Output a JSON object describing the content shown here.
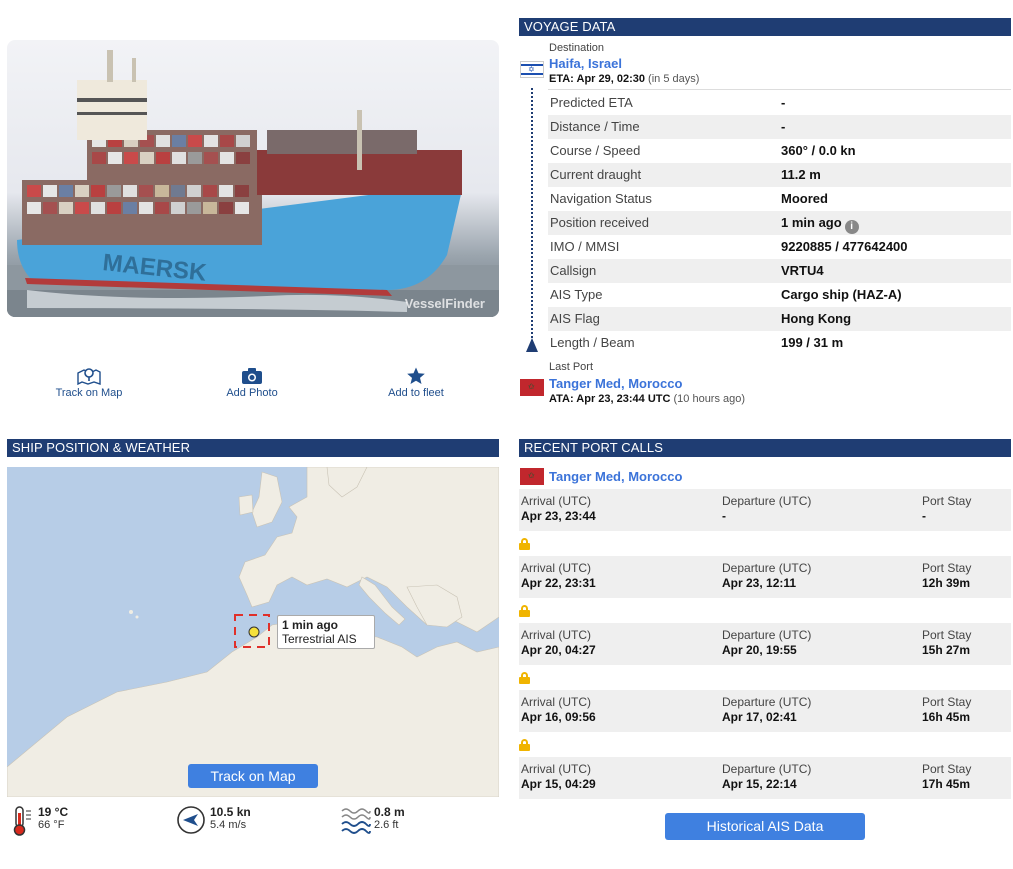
{
  "photo": {
    "watermark": "VesselFinder",
    "hull_text": "MAERSK"
  },
  "actions": [
    {
      "label": "Track on Map",
      "icon": "map-pin-icon"
    },
    {
      "label": "Add Photo",
      "icon": "camera-icon"
    },
    {
      "label": "Add to fleet",
      "icon": "star-icon"
    }
  ],
  "voyage": {
    "header": "VOYAGE DATA",
    "destination": {
      "label": "Destination",
      "port": "Haifa, Israel",
      "eta_prefix": "ETA: Apr 29, 02:30",
      "eta_note": "(in 5 days)"
    },
    "rows": [
      {
        "label": "Predicted ETA",
        "value": "-"
      },
      {
        "label": "Distance / Time",
        "value": "-"
      },
      {
        "label": "Course / Speed",
        "value": "360° / 0.0 kn"
      },
      {
        "label": "Current draught",
        "value": "11.2 m"
      },
      {
        "label": "Navigation Status",
        "value": "Moored"
      },
      {
        "label": "Position received",
        "value": "1 min ago"
      },
      {
        "label": "IMO / MMSI",
        "value": "9220885 / 477642400"
      },
      {
        "label": "Callsign",
        "value": "VRTU4"
      },
      {
        "label": "AIS Type",
        "value": "Cargo ship (HAZ-A)"
      },
      {
        "label": "AIS Flag",
        "value": "Hong Kong"
      },
      {
        "label": "Length / Beam",
        "value": "199 / 31 m"
      }
    ],
    "last_port": {
      "label": "Last Port",
      "port": "Tanger Med, Morocco",
      "ata_prefix": "ATA: Apr 23, 23:44 UTC",
      "ata_note": "(10 hours ago)"
    }
  },
  "map": {
    "header": "SHIP POSITION & WEATHER",
    "tooltip_time": "1 min ago",
    "tooltip_source": "Terrestrial AIS",
    "button": "Track on Map",
    "colors": {
      "sea": "#b7cde7",
      "land": "#f0ede4"
    }
  },
  "weather": {
    "temp_c": "19 °C",
    "temp_f": "66 °F",
    "wind_kn": "10.5 kn",
    "wind_ms": "5.4 m/s",
    "wave_m": "0.8 m",
    "wave_ft": "2.6 ft"
  },
  "port_calls": {
    "header": "RECENT PORT CALLS",
    "port": "Tanger Med, Morocco",
    "col_arrival": "Arrival (UTC)",
    "col_departure": "Departure (UTC)",
    "col_stay": "Port Stay",
    "rows": [
      {
        "arrival": "Apr 23, 23:44",
        "departure": "-",
        "stay": "-"
      },
      {
        "arrival": "Apr 22, 23:31",
        "departure": "Apr 23, 12:11",
        "stay": "12h 39m"
      },
      {
        "arrival": "Apr 20, 04:27",
        "departure": "Apr 20, 19:55",
        "stay": "15h 27m"
      },
      {
        "arrival": "Apr 16, 09:56",
        "departure": "Apr 17, 02:41",
        "stay": "16h 45m"
      },
      {
        "arrival": "Apr 15, 04:29",
        "departure": "Apr 15, 22:14",
        "stay": "17h 45m"
      }
    ],
    "history_button": "Historical AIS Data"
  }
}
